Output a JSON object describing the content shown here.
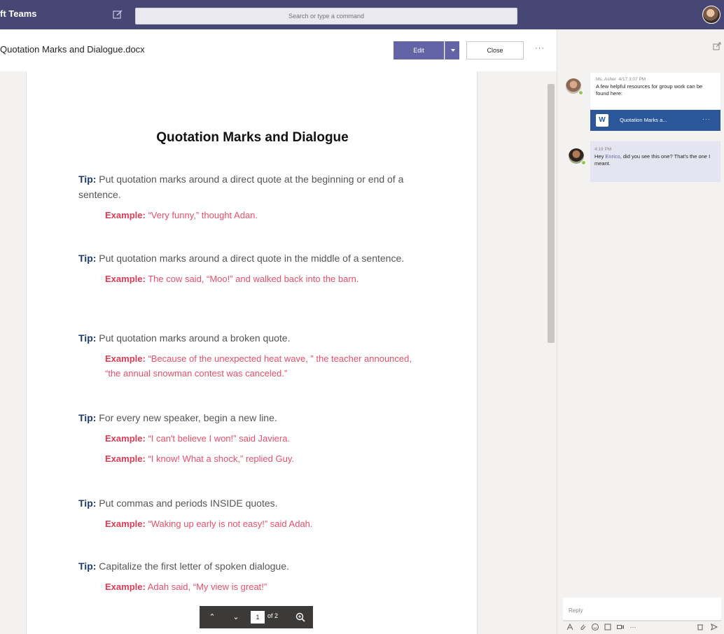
{
  "app": {
    "title": "ft Teams",
    "search_placeholder": "Search or type a command"
  },
  "doc_header": {
    "filename": "Quotation Marks and Dialogue.docx",
    "edit_label": "Edit",
    "close_label": "Close",
    "more_label": "···"
  },
  "document": {
    "heading": "Quotation Marks and Dialogue",
    "tip_label": "Tip:",
    "example_label": "Example:",
    "tips": [
      {
        "text": " Put quotation marks around a direct quote at the beginning or end of a sentence.",
        "examples": [
          "“Very funny,” thought Adan."
        ]
      },
      {
        "text": " Put quotation marks around a direct quote in the middle of a sentence.",
        "examples": [
          "The cow said, “Moo!” and walked back into the barn."
        ]
      },
      {
        "text": " Put quotation marks around a broken quote.",
        "examples": [
          "“Because of the unexpected heat wave, ” the teacher announced, “the annual snowman contest was canceled.”"
        ]
      },
      {
        "text": " For every new speaker, begin a new line.",
        "examples": [
          "“I can't believe I won!” said Javiera.",
          "“I know! What a shock,” replied Guy."
        ]
      },
      {
        "text": " Put commas and periods INSIDE quotes.",
        "examples": [
          "“Waking up early is not easy!” said Adah."
        ]
      },
      {
        "text": " Capitalize the first letter of spoken dialogue.",
        "examples": [
          "Adah said, “My view is great!”"
        ]
      }
    ]
  },
  "pager": {
    "current_page": "1",
    "of_label": "of 2"
  },
  "chat": {
    "messages": [
      {
        "author": "Ms. Asher",
        "time": "4/17 3:07 PM",
        "text": "A few helpful resources for group work can be found here:"
      },
      {
        "time": "4:19 PM",
        "text_before": "Hey ",
        "mention": "Enrico",
        "text_after": ", did you see this one? That's the one I meant."
      }
    ],
    "attachment": {
      "name": "Quotation Marks a...",
      "icon": "W",
      "more": "···"
    },
    "reply_placeholder": "Reply",
    "tools_more": "···"
  }
}
